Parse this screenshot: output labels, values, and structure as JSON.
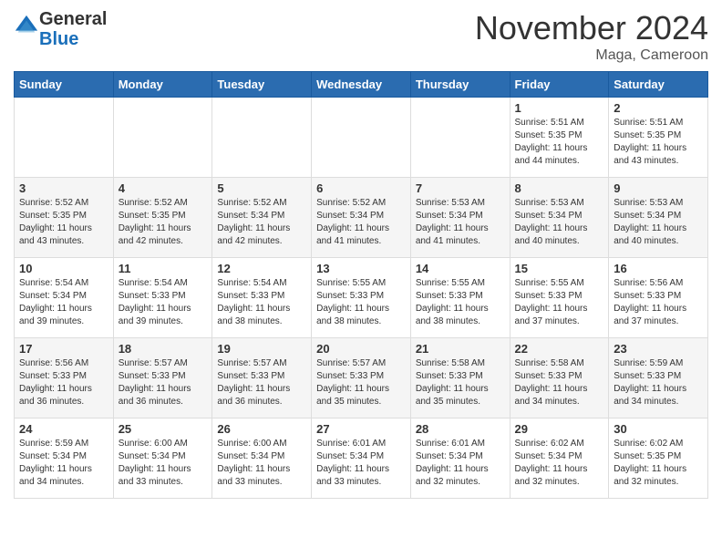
{
  "header": {
    "logo_general": "General",
    "logo_blue": "Blue",
    "month_title": "November 2024",
    "location": "Maga, Cameroon"
  },
  "days_of_week": [
    "Sunday",
    "Monday",
    "Tuesday",
    "Wednesday",
    "Thursday",
    "Friday",
    "Saturday"
  ],
  "weeks": [
    [
      {
        "day": "",
        "info": ""
      },
      {
        "day": "",
        "info": ""
      },
      {
        "day": "",
        "info": ""
      },
      {
        "day": "",
        "info": ""
      },
      {
        "day": "",
        "info": ""
      },
      {
        "day": "1",
        "info": "Sunrise: 5:51 AM\nSunset: 5:35 PM\nDaylight: 11 hours\nand 44 minutes."
      },
      {
        "day": "2",
        "info": "Sunrise: 5:51 AM\nSunset: 5:35 PM\nDaylight: 11 hours\nand 43 minutes."
      }
    ],
    [
      {
        "day": "3",
        "info": "Sunrise: 5:52 AM\nSunset: 5:35 PM\nDaylight: 11 hours\nand 43 minutes."
      },
      {
        "day": "4",
        "info": "Sunrise: 5:52 AM\nSunset: 5:35 PM\nDaylight: 11 hours\nand 42 minutes."
      },
      {
        "day": "5",
        "info": "Sunrise: 5:52 AM\nSunset: 5:34 PM\nDaylight: 11 hours\nand 42 minutes."
      },
      {
        "day": "6",
        "info": "Sunrise: 5:52 AM\nSunset: 5:34 PM\nDaylight: 11 hours\nand 41 minutes."
      },
      {
        "day": "7",
        "info": "Sunrise: 5:53 AM\nSunset: 5:34 PM\nDaylight: 11 hours\nand 41 minutes."
      },
      {
        "day": "8",
        "info": "Sunrise: 5:53 AM\nSunset: 5:34 PM\nDaylight: 11 hours\nand 40 minutes."
      },
      {
        "day": "9",
        "info": "Sunrise: 5:53 AM\nSunset: 5:34 PM\nDaylight: 11 hours\nand 40 minutes."
      }
    ],
    [
      {
        "day": "10",
        "info": "Sunrise: 5:54 AM\nSunset: 5:34 PM\nDaylight: 11 hours\nand 39 minutes."
      },
      {
        "day": "11",
        "info": "Sunrise: 5:54 AM\nSunset: 5:33 PM\nDaylight: 11 hours\nand 39 minutes."
      },
      {
        "day": "12",
        "info": "Sunrise: 5:54 AM\nSunset: 5:33 PM\nDaylight: 11 hours\nand 38 minutes."
      },
      {
        "day": "13",
        "info": "Sunrise: 5:55 AM\nSunset: 5:33 PM\nDaylight: 11 hours\nand 38 minutes."
      },
      {
        "day": "14",
        "info": "Sunrise: 5:55 AM\nSunset: 5:33 PM\nDaylight: 11 hours\nand 38 minutes."
      },
      {
        "day": "15",
        "info": "Sunrise: 5:55 AM\nSunset: 5:33 PM\nDaylight: 11 hours\nand 37 minutes."
      },
      {
        "day": "16",
        "info": "Sunrise: 5:56 AM\nSunset: 5:33 PM\nDaylight: 11 hours\nand 37 minutes."
      }
    ],
    [
      {
        "day": "17",
        "info": "Sunrise: 5:56 AM\nSunset: 5:33 PM\nDaylight: 11 hours\nand 36 minutes."
      },
      {
        "day": "18",
        "info": "Sunrise: 5:57 AM\nSunset: 5:33 PM\nDaylight: 11 hours\nand 36 minutes."
      },
      {
        "day": "19",
        "info": "Sunrise: 5:57 AM\nSunset: 5:33 PM\nDaylight: 11 hours\nand 36 minutes."
      },
      {
        "day": "20",
        "info": "Sunrise: 5:57 AM\nSunset: 5:33 PM\nDaylight: 11 hours\nand 35 minutes."
      },
      {
        "day": "21",
        "info": "Sunrise: 5:58 AM\nSunset: 5:33 PM\nDaylight: 11 hours\nand 35 minutes."
      },
      {
        "day": "22",
        "info": "Sunrise: 5:58 AM\nSunset: 5:33 PM\nDaylight: 11 hours\nand 34 minutes."
      },
      {
        "day": "23",
        "info": "Sunrise: 5:59 AM\nSunset: 5:33 PM\nDaylight: 11 hours\nand 34 minutes."
      }
    ],
    [
      {
        "day": "24",
        "info": "Sunrise: 5:59 AM\nSunset: 5:34 PM\nDaylight: 11 hours\nand 34 minutes."
      },
      {
        "day": "25",
        "info": "Sunrise: 6:00 AM\nSunset: 5:34 PM\nDaylight: 11 hours\nand 33 minutes."
      },
      {
        "day": "26",
        "info": "Sunrise: 6:00 AM\nSunset: 5:34 PM\nDaylight: 11 hours\nand 33 minutes."
      },
      {
        "day": "27",
        "info": "Sunrise: 6:01 AM\nSunset: 5:34 PM\nDaylight: 11 hours\nand 33 minutes."
      },
      {
        "day": "28",
        "info": "Sunrise: 6:01 AM\nSunset: 5:34 PM\nDaylight: 11 hours\nand 32 minutes."
      },
      {
        "day": "29",
        "info": "Sunrise: 6:02 AM\nSunset: 5:34 PM\nDaylight: 11 hours\nand 32 minutes."
      },
      {
        "day": "30",
        "info": "Sunrise: 6:02 AM\nSunset: 5:35 PM\nDaylight: 11 hours\nand 32 minutes."
      }
    ]
  ]
}
